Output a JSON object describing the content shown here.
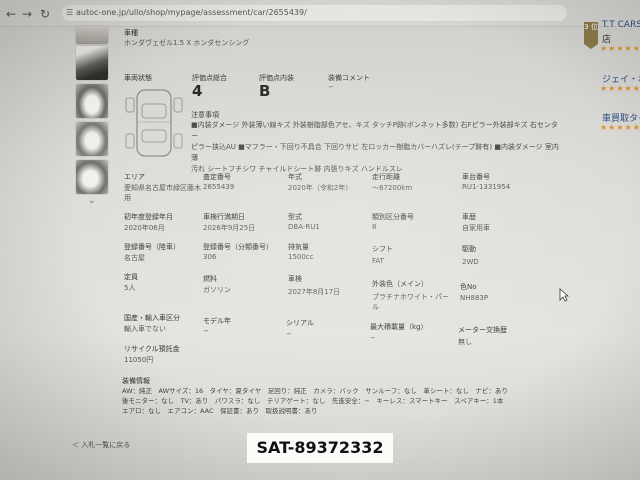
{
  "browser": {
    "url": "autoc-one.jp/ullo/shop/mypage/assessment/car/2655439/",
    "back_icon": "arrow-left-icon",
    "forward_icon": "arrow-right-icon",
    "reload_icon": "reload-icon",
    "tune_icon": "tune-icon"
  },
  "sidebar": {
    "badge": "3 位",
    "shops": [
      {
        "name": "T.T CARS",
        "sub": "店",
        "stars": "★★★★★"
      },
      {
        "name": "ジェイ・ボ",
        "stars": "★★★★★"
      },
      {
        "name": "車買取タイ",
        "stars": "★★★★★"
      }
    ]
  },
  "car": {
    "type_label": "車種",
    "type_value": "ホンダヴェゼル1.5 X ホンダセンシング",
    "condition_label": "車両状態",
    "overall_label": "評価点総合",
    "overall_value": "4",
    "interior_label": "評価点内装",
    "interior_value": "B",
    "comment_label": "装備コメント",
    "comment_value": "−",
    "notes_label": "注意事項",
    "notes_lines": [
      "■内装ダメージ 外装薄い線キズ 外装樹脂部色アセ、キズ タッチP跡(ボンネット多数) 右Fピラー外装部キズ 右センター",
      "ピラー挟込AU ■マフラー・下回り不具合 下回りサビ 左ロッカー樹脂カバーハズレ(テープ跡有) ■内装ダメージ 室内薄",
      "汚れ シートフチシワ チャイルドシート跡 内張りキズ ハンドルスレ"
    ]
  },
  "specs": [
    {
      "label": "エリア",
      "value": "愛知県名古屋市緑区藤木"
    },
    {
      "label": "",
      "value": "用"
    },
    {
      "label": "査定番号",
      "value": "2655439"
    },
    {
      "label": "年式",
      "value": "2020年（令和2年）"
    },
    {
      "label": "走行距離",
      "value": "〜87200km"
    },
    {
      "label": "車台番号",
      "value": "RU1-1331954"
    },
    {
      "label": "初年度登録年月",
      "value": "2020年06月"
    },
    {
      "label": "車検行満期日",
      "value": "2026年9月25日"
    },
    {
      "label": "型式",
      "value": "DBA-RU1"
    },
    {
      "label": "類別区分番号",
      "value": "8"
    },
    {
      "label": "車歴",
      "value": "自家用車"
    },
    {
      "label": "登録番号（陸車）",
      "value": "名古屋"
    },
    {
      "label": "登録番号（分類番号）",
      "value": "306"
    },
    {
      "label": "排気量",
      "value": "1500cc"
    },
    {
      "label": "シフト",
      "value": "FAT"
    },
    {
      "label": "駆動",
      "value": "2WD"
    },
    {
      "label": "定員",
      "value": "5人"
    },
    {
      "label": "燃料",
      "value": "ガソリン"
    },
    {
      "label": "車検",
      "value": "2027年8月17日"
    },
    {
      "label": "外装色（メイン）",
      "value": "プラチナホワイト・パー"
    },
    {
      "label": "",
      "value": "ル"
    },
    {
      "label": "色No",
      "value": "NH883P"
    },
    {
      "label": "国産・輸入車区分",
      "value": "輸入車でない"
    },
    {
      "label": "モデル年",
      "value": "−"
    },
    {
      "label": "シリアル",
      "value": "−"
    },
    {
      "label": "最大積載量（kg）",
      "value": "−"
    },
    {
      "label": "メーター交換歴",
      "value": "無し"
    },
    {
      "label": "リサイクル預託金",
      "value": "11050円"
    }
  ],
  "equipment": {
    "label": "装備情報",
    "lines": [
      "AW：純正　AWサイズ：16　タイヤ：夏タイヤ　足回り：純正　カメラ：バック　サンルーフ：なし　革シート：なし　ナビ：あり",
      "後モニター：なし　TV：あり　パワスラ：なし　テリアゲート：なし　先進安全：−　キーレス：スマートキー　スペアキー：1本",
      "エアロ：なし　エアコン：AAC　保証書：あり　取扱説明書：あり"
    ]
  },
  "back_link": "＜ 入札一覧に戻る",
  "plate": "SAT-89372332"
}
